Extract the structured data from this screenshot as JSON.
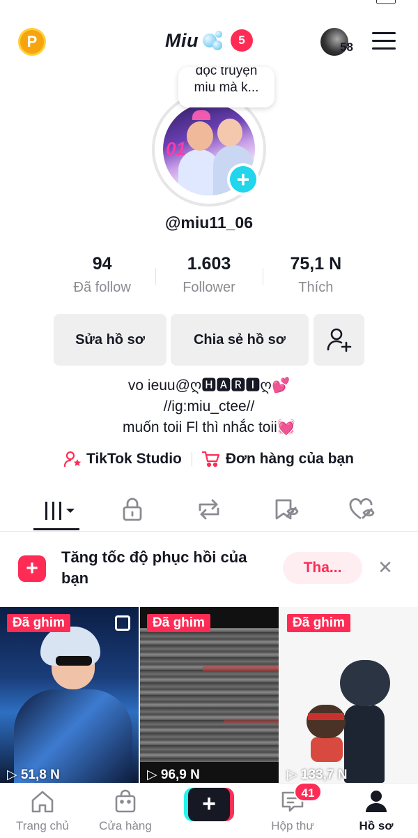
{
  "header": {
    "coin_label": "P",
    "title": "Miu",
    "notification_count": "5",
    "story_count": "58"
  },
  "profile": {
    "note_lines": [
      "đọc truyện",
      "miu mà k..."
    ],
    "handle": "@miu11_06",
    "stats": [
      {
        "value": "94",
        "label": "Đã follow"
      },
      {
        "value": "1.603",
        "label": "Follower"
      },
      {
        "value": "75,1 N",
        "label": "Thích"
      }
    ],
    "buttons": {
      "edit": "Sửa hồ sơ",
      "share": "Chia sẻ hồ sơ"
    },
    "bio": [
      "vo ieuu@ღ🅷🅰🆁🅸ღ💕",
      "//ig:miu_ctee//",
      "muốn toii Fl thì nhắc toii💓"
    ],
    "links": {
      "studio": "TikTok Studio",
      "orders": "Đơn hàng của bạn"
    }
  },
  "tabs": [
    {
      "icon": "grid-icon",
      "active": true
    },
    {
      "icon": "lock-icon",
      "active": false
    },
    {
      "icon": "repost-icon",
      "active": false
    },
    {
      "icon": "favorites-icon",
      "active": false
    },
    {
      "icon": "liked-icon",
      "active": false
    }
  ],
  "promo": {
    "text": "Tăng tốc độ phục hồi của bạn",
    "button": "Tha..."
  },
  "videos": [
    {
      "pinned_label": "Đã ghim",
      "views": "51,8 N"
    },
    {
      "pinned_label": "Đã ghim",
      "views": "96,9 N"
    },
    {
      "pinned_label": "Đã ghim",
      "views": "133,7 N"
    }
  ],
  "bottom_nav": {
    "home": "Trang chủ",
    "shop": "Cửa hàng",
    "inbox": "Hộp thư",
    "inbox_badge": "41",
    "profile": "Hồ sơ"
  },
  "colors": {
    "brand_red": "#fe2c55",
    "brand_cyan": "#25f4ee",
    "text": "#161823",
    "muted": "#8a8b91"
  }
}
